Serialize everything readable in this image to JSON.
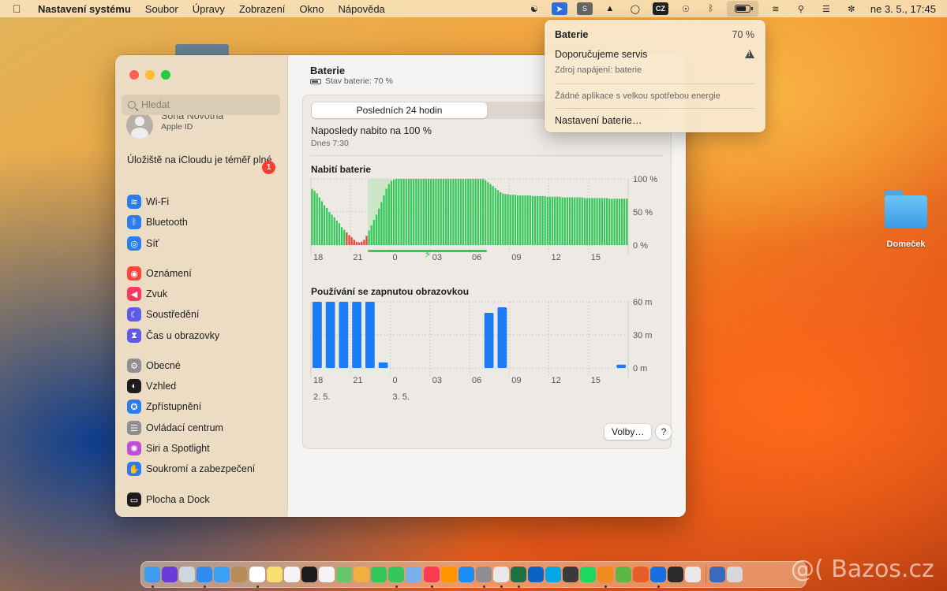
{
  "menubar": {
    "app_name": "Nastavení systému",
    "menus": [
      "Soubor",
      "Úpravy",
      "Zobrazení",
      "Okno",
      "Nápověda"
    ],
    "input_source": "CZ",
    "clock": "ne 3. 5.,  17:45"
  },
  "desktop": {
    "folder_label": "Domeček"
  },
  "window": {
    "search_placeholder": "Hledat",
    "account": {
      "name": "Soňa Novotná",
      "subtitle": "Apple ID"
    },
    "icloud_notice": "Úložiště na iCloudu je téměř plné",
    "icloud_badge": "1",
    "sidebar_items": [
      {
        "label": "Wi-Fi",
        "color": "#2a7cf0",
        "icon": "wifi-icon",
        "glyph": "≋"
      },
      {
        "label": "Bluetooth",
        "color": "#2a7cf0",
        "icon": "bluetooth-icon",
        "glyph": "ᛒ"
      },
      {
        "label": "Síť",
        "color": "#2a7cf0",
        "icon": "globe-icon",
        "glyph": "◎"
      },
      {
        "label": "Oznámení",
        "color": "#ff453a",
        "icon": "bell-icon",
        "glyph": "◉"
      },
      {
        "label": "Zvuk",
        "color": "#ff375f",
        "icon": "speaker-icon",
        "glyph": "◀"
      },
      {
        "label": "Soustředění",
        "color": "#5e5ce6",
        "icon": "moon-icon",
        "glyph": "☾"
      },
      {
        "label": "Čas u obrazovky",
        "color": "#5e5ce6",
        "icon": "hourglass-icon",
        "glyph": "⧗"
      },
      {
        "label": "Obecné",
        "color": "#8e8e93",
        "icon": "gear-icon",
        "glyph": "⚙"
      },
      {
        "label": "Vzhled",
        "color": "#1c1c1e",
        "icon": "appearance-icon",
        "glyph": "◐"
      },
      {
        "label": "Zpřístupnění",
        "color": "#2a7cf0",
        "icon": "accessibility-icon",
        "glyph": "✪"
      },
      {
        "label": "Ovládací centrum",
        "color": "#8e8e93",
        "icon": "control-center-icon",
        "glyph": "☰"
      },
      {
        "label": "Siri a Spotlight",
        "color": "#c04fd8",
        "icon": "siri-icon",
        "glyph": "✺"
      },
      {
        "label": "Soukromí a zabezpečení",
        "color": "#2a7cf0",
        "icon": "hand-icon",
        "glyph": "✋"
      },
      {
        "label": "Plocha a Dock",
        "color": "#1c1c1e",
        "icon": "dock-icon",
        "glyph": "▭"
      }
    ],
    "main": {
      "title": "Baterie",
      "status": "Stav baterie: 70 %",
      "segments": [
        "Posledních 24 hodin",
        "Po"
      ],
      "last_charged": "Naposledy nabito na 100 %",
      "last_charged_time": "Dnes 7:30",
      "battery_section": "Nabití baterie",
      "screen_section": "Používání se zapnutou obrazovkou",
      "options_button": "Volby…",
      "help_button": "?"
    }
  },
  "chart_data": [
    {
      "type": "bar",
      "title": "Nabití baterie",
      "x_tick_labels": [
        "18",
        "21",
        "0",
        "03",
        "06",
        "09",
        "12",
        "15"
      ],
      "y_tick_labels": [
        "100 %",
        "50 %",
        "0 %"
      ],
      "ylim": [
        0,
        100
      ],
      "values": [
        85,
        82,
        78,
        72,
        66,
        60,
        56,
        50,
        46,
        42,
        37,
        33,
        27,
        23,
        19,
        15,
        12,
        8,
        5,
        4,
        5,
        8,
        14,
        22,
        30,
        38,
        46,
        55,
        65,
        75,
        85,
        92,
        97,
        99,
        100,
        100,
        100,
        100,
        100,
        100,
        100,
        100,
        100,
        100,
        100,
        100,
        100,
        100,
        100,
        100,
        100,
        100,
        100,
        100,
        100,
        100,
        100,
        100,
        100,
        100,
        100,
        100,
        100,
        100,
        100,
        100,
        100,
        100,
        100,
        100,
        98,
        95,
        92,
        89,
        86,
        83,
        80,
        78,
        77,
        77,
        76,
        76,
        76,
        75,
        75,
        75,
        75,
        75,
        75,
        74,
        74,
        74,
        74,
        74,
        74,
        73,
        73,
        73,
        73,
        73,
        73,
        72,
        72,
        72,
        72,
        72,
        72,
        72,
        72,
        72,
        71,
        71,
        71,
        71,
        71,
        71,
        71,
        71,
        71,
        71,
        70,
        70,
        70,
        70,
        70,
        70,
        70,
        70
      ],
      "low_threshold": 20,
      "charging_range_index": [
        22,
        71
      ]
    },
    {
      "type": "bar",
      "title": "Používání se zapnutou obrazovkou",
      "x_tick_labels": [
        "18",
        "21",
        "0",
        "03",
        "06",
        "09",
        "12",
        "15"
      ],
      "date_labels": [
        "2. 5.",
        "3. 5."
      ],
      "y_tick_labels": [
        "60 m",
        "30 m",
        "0 m"
      ],
      "ylim": [
        0,
        60
      ],
      "values": [
        60,
        60,
        60,
        60,
        60,
        5,
        0,
        0,
        0,
        0,
        0,
        0,
        0,
        50,
        55,
        0,
        0,
        0,
        0,
        0,
        0,
        0,
        0,
        3
      ]
    }
  ],
  "battery_menu": {
    "title": "Baterie",
    "percent": "70 %",
    "service": "Doporučujeme servis",
    "source": "Zdroj napájení: baterie",
    "apps_notice": "Žádné aplikace s velkou spotřebou energie",
    "settings": "Nastavení baterie…"
  },
  "dock_apps": [
    {
      "name": "finder-icon",
      "color": "#3b9cf0"
    },
    {
      "name": "siri-icon",
      "color": "#6a3bd8"
    },
    {
      "name": "launchpad-icon",
      "color": "#d0d6e0"
    },
    {
      "name": "safari-icon",
      "color": "#2f8cf0"
    },
    {
      "name": "mail-icon",
      "color": "#3aa0f4"
    },
    {
      "name": "contacts-icon",
      "color": "#b88c58"
    },
    {
      "name": "calendar-icon",
      "color": "#ffffff"
    },
    {
      "name": "notes-icon",
      "color": "#f8e070"
    },
    {
      "name": "reminders-icon",
      "color": "#f4f4f4"
    },
    {
      "name": "appletv-icon",
      "color": "#1c1c1e"
    },
    {
      "name": "freeform-icon",
      "color": "#f4f4f4"
    },
    {
      "name": "maps-icon",
      "color": "#6ac46c"
    },
    {
      "name": "photos-icon",
      "color": "#f0b040"
    },
    {
      "name": "facetime-icon",
      "color": "#34c759"
    },
    {
      "name": "messages-icon",
      "color": "#34c759"
    },
    {
      "name": "preview-icon",
      "color": "#7ab0e8"
    },
    {
      "name": "music-icon",
      "color": "#fa3c50"
    },
    {
      "name": "books-icon",
      "color": "#ff9500"
    },
    {
      "name": "appstore-icon",
      "color": "#1b8cf4"
    },
    {
      "name": "settings-icon",
      "color": "#8e8e93"
    },
    {
      "name": "chrome-icon",
      "color": "#e8e8e8"
    },
    {
      "name": "excel-icon",
      "color": "#1d7044"
    },
    {
      "name": "outlook-icon",
      "color": "#0a64c8"
    },
    {
      "name": "skype-icon",
      "color": "#00a8e8"
    },
    {
      "name": "scrivener-icon",
      "color": "#3a3a3a"
    },
    {
      "name": "spotify-icon",
      "color": "#1ed760"
    },
    {
      "name": "vlc-icon",
      "color": "#f08a1c"
    },
    {
      "name": "utorrent-icon",
      "color": "#5cb842"
    },
    {
      "name": "firefox-icon",
      "color": "#e65c2a"
    },
    {
      "name": "xcode-icon",
      "color": "#1a6fe0"
    },
    {
      "name": "messenger-icon",
      "color": "#2a2a2a"
    },
    {
      "name": "chrome2-icon",
      "color": "#e8e8e8"
    },
    {
      "name": "downloads-icon",
      "color": "#3a6ac0"
    },
    {
      "name": "trash-icon",
      "color": "#d8d8d8"
    }
  ],
  "watermark": "@( Bazos.cz"
}
